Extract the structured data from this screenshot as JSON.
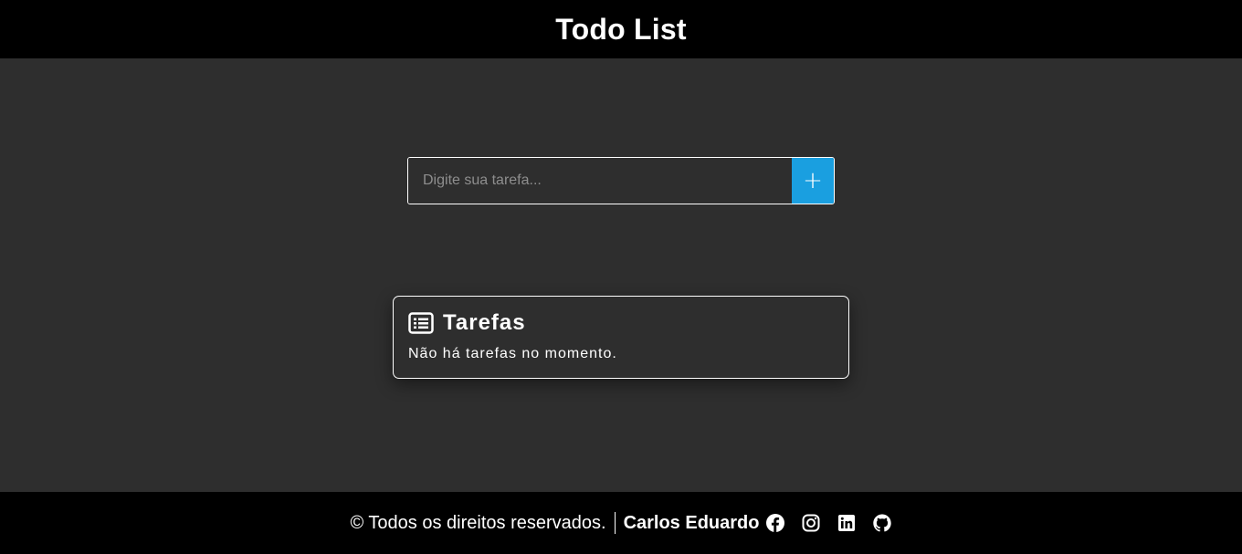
{
  "header": {
    "title": "Todo List"
  },
  "task_input": {
    "placeholder": "Digite sua tarefa...",
    "value": "",
    "add_label": "+"
  },
  "tasks_card": {
    "icon": "list-icon",
    "title": "Tarefas",
    "empty_message": "Não há tarefas no momento."
  },
  "footer": {
    "copyright": "© Todos os direitos reservados.",
    "author": "Carlos Eduardo",
    "socials": [
      {
        "icon": "facebook-icon"
      },
      {
        "icon": "instagram-icon"
      },
      {
        "icon": "linkedin-icon"
      },
      {
        "icon": "github-icon"
      }
    ]
  },
  "colors": {
    "background": "#2e2e2e",
    "bar": "#000000",
    "accent": "#1a9fe0",
    "text": "#ffffff"
  }
}
